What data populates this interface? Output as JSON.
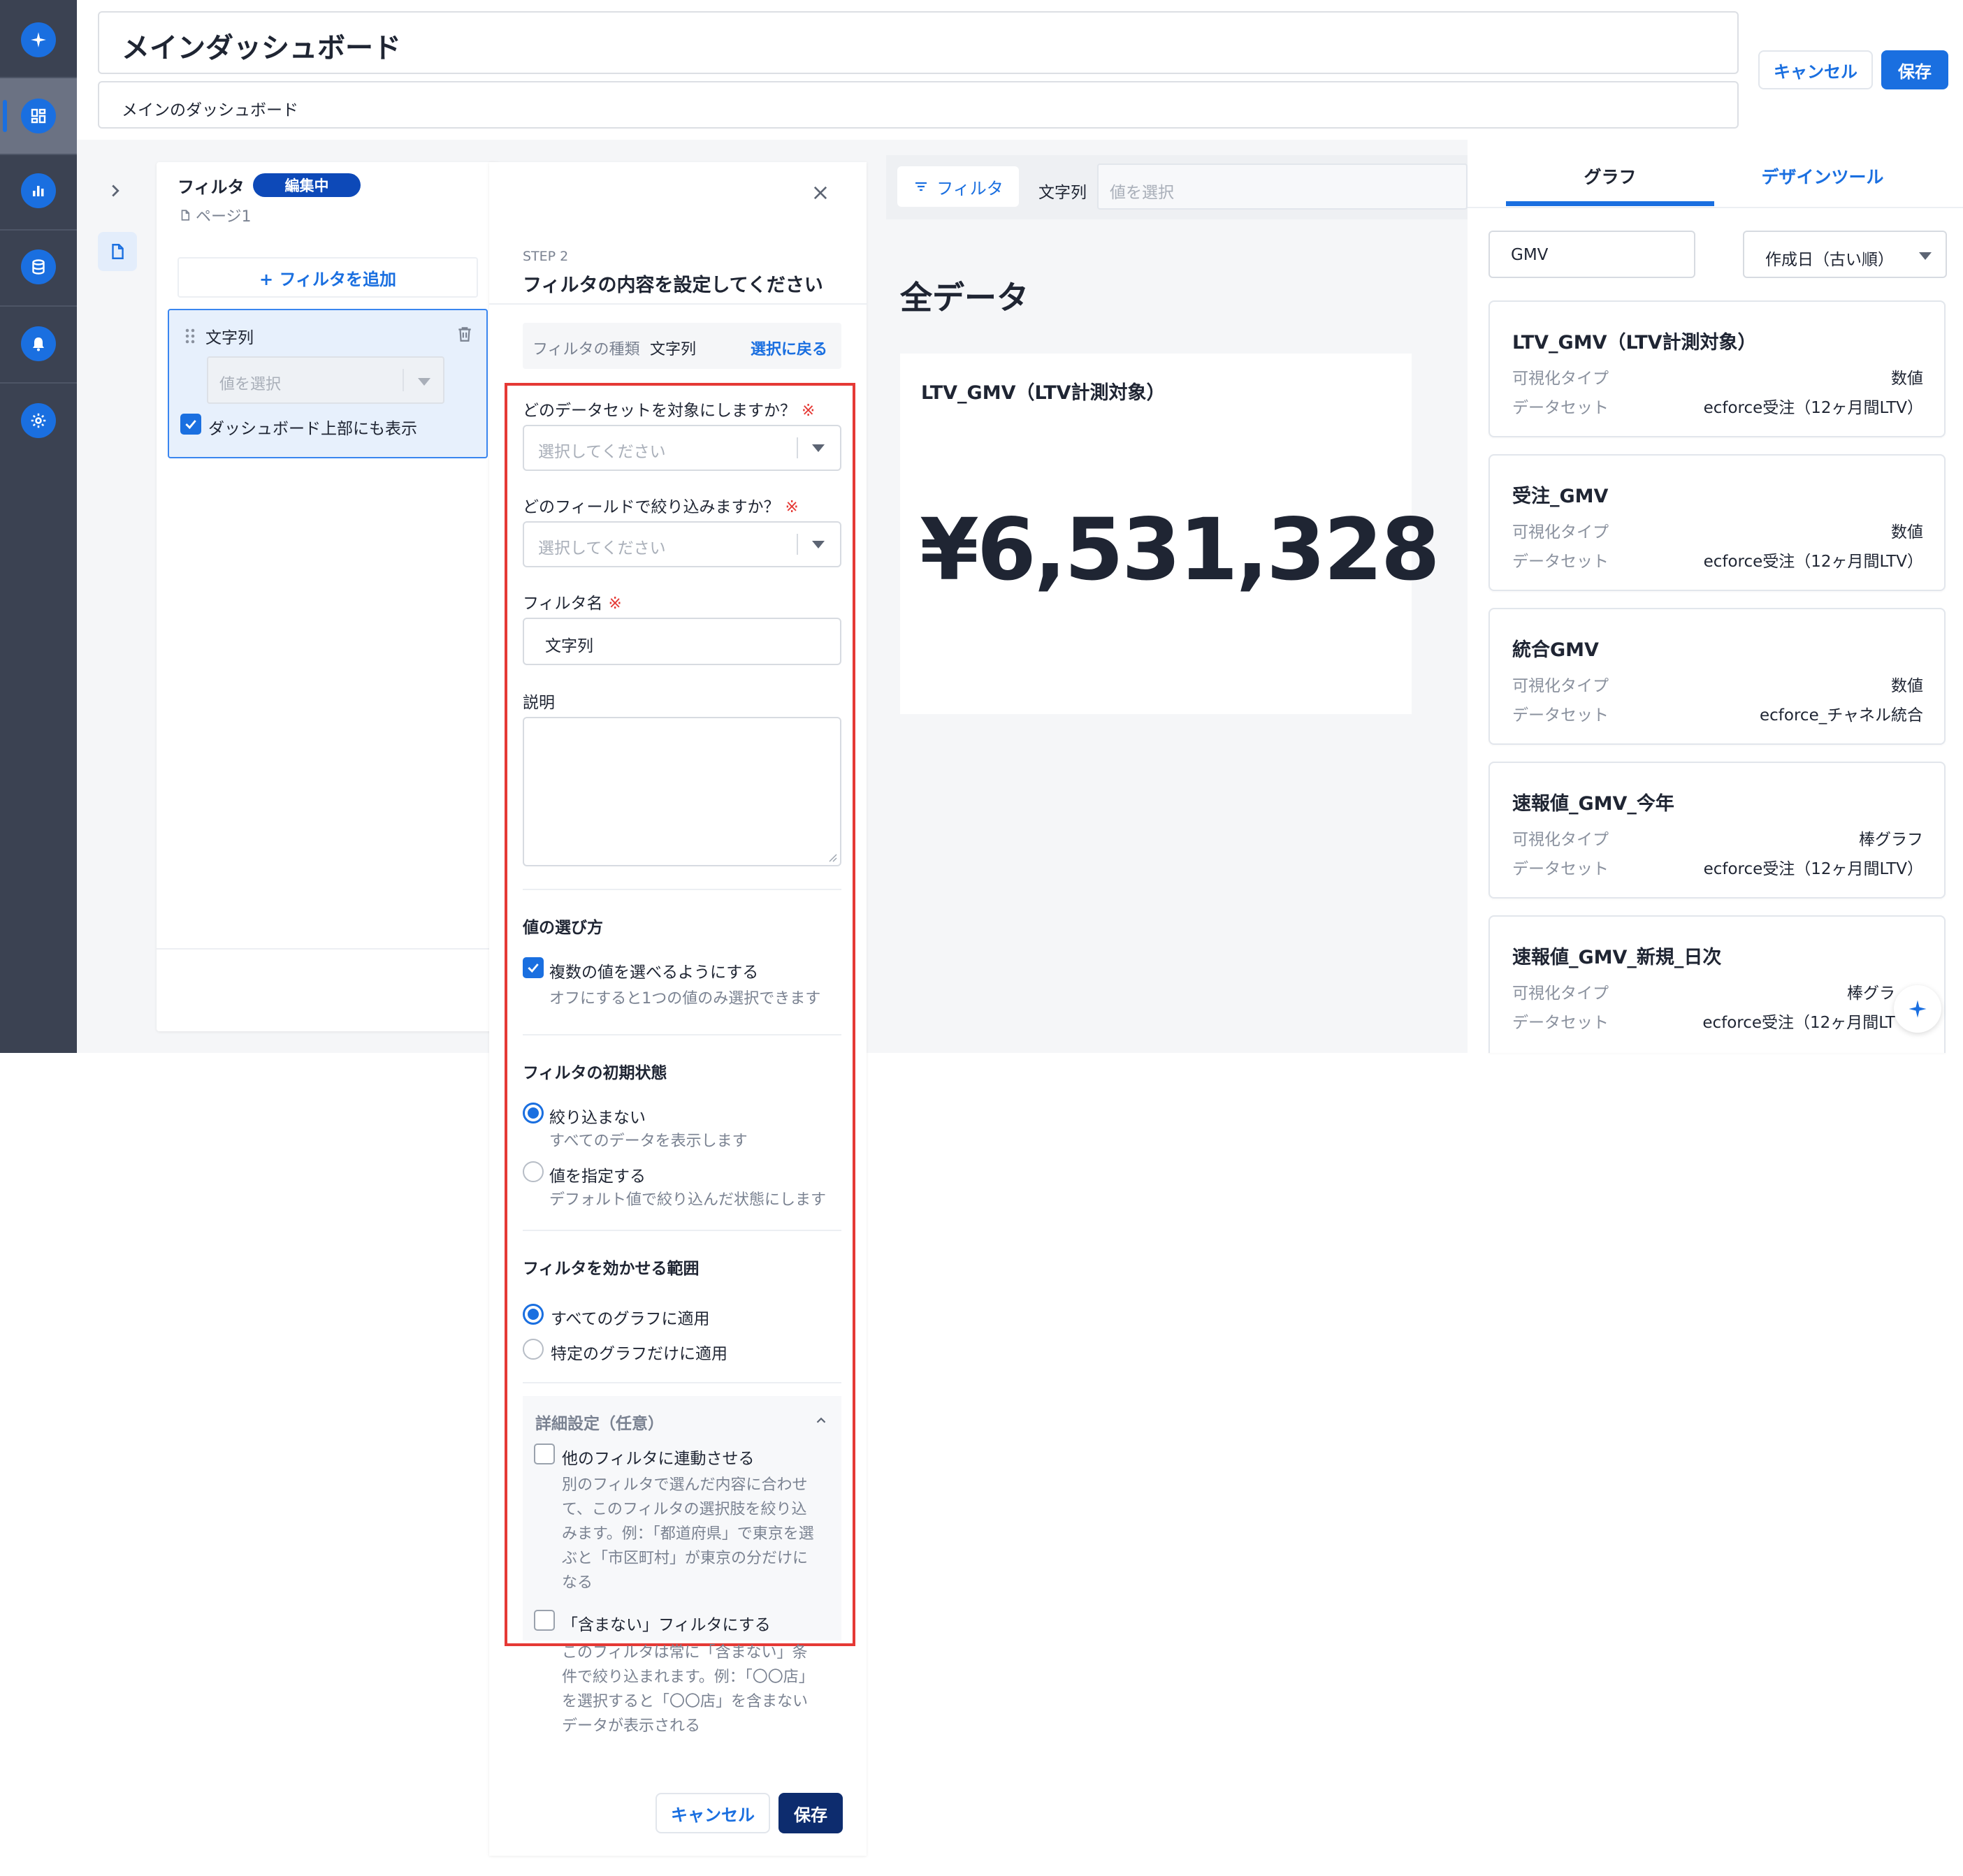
{
  "colors": {
    "accent": "#1a6fe0",
    "sidebar": "#3b4252",
    "primary_dark": "#0d2c6e",
    "required": "#e53935",
    "highlight_border": "#e53935"
  },
  "sidebar": {
    "items": [
      {
        "icon": "sparkle-icon"
      },
      {
        "icon": "dashboard-grid-icon",
        "active": true
      },
      {
        "icon": "bar-chart-icon"
      },
      {
        "icon": "database-icon"
      },
      {
        "icon": "bell-icon"
      },
      {
        "icon": "gear-icon"
      }
    ]
  },
  "header": {
    "title": "メインダッシュボード",
    "subtitle": "メインのダッシュボード",
    "cancel_label": "キャンセル",
    "save_label": "保存"
  },
  "filter_panel": {
    "title": "フィルタ",
    "badge": "編集中",
    "page": "ページ1",
    "add_filter_label": "+ フィルタを追加",
    "item": {
      "name": "文字列",
      "value_placeholder": "値を選択",
      "show_on_top_label": "ダッシュボード上部にも表示",
      "show_on_top_checked": true
    }
  },
  "step": {
    "step_label": "STEP 2",
    "title": "フィルタの内容を設定してください",
    "type_label": "フィルタの種類",
    "type_value": "文字列",
    "back_label": "選択に戻る",
    "dataset_label": "どのデータセットを対象にしますか？",
    "field_label": "どのフィールドで絞り込みますか？",
    "required_mark": "※",
    "select_placeholder": "選択してください",
    "name_label": "フィルタ名",
    "name_value": "文字列",
    "description_label": "説明",
    "value_section": "値の選び方",
    "multi_label": "複数の値を選べるようにする",
    "multi_help": "オフにすると1つの値のみ選択できます",
    "multi_checked": true,
    "initial_section": "フィルタの初期状態",
    "no_filter_label": "絞り込まない",
    "no_filter_help": "すべてのデータを表示します",
    "specify_label": "値を指定する",
    "specify_help": "デフォルト値で絞り込んだ状態にします",
    "scope_section": "フィルタを効かせる範囲",
    "scope_all": "すべてのグラフに適用",
    "scope_specific": "特定のグラフだけに適用",
    "advanced_label": "詳細設定（任意）",
    "link_label": "他のフィルタに連動させる",
    "link_help_lines": [
      "別のフィルタで選んだ内容に合わせ",
      "て、このフィルタの選択肢を絞り込",
      "みます。例：「都道府県」で東京を選",
      "ぶと「市区町村」が東京の分だけに",
      "なる"
    ],
    "exclude_label": "「含まない」フィルタにする",
    "exclude_help_lines": [
      "このフィルタは常に「含まない」条",
      "件で絞り込まれます。例：「〇〇店」",
      "を選択すると「〇〇店」を含まない",
      "データが表示される"
    ],
    "cancel_label": "キャンセル",
    "save_label": "保存"
  },
  "preview": {
    "filter_chip": "フィルタ",
    "field_label": "文字列",
    "value_placeholder": "値を選択",
    "section_title": "全データ",
    "kpi_title": "LTV_GMV（LTV計測対象）",
    "kpi_value": "¥6,531,328"
  },
  "right_panel": {
    "tabs": [
      "グラフ",
      "デザインツール"
    ],
    "active_tab": 0,
    "search_value": "GMV",
    "sort_value": "作成日（古い順）",
    "viz_key": "可視化タイプ",
    "dataset_key": "データセット",
    "cards": [
      {
        "title": "LTV_GMV（LTV計測対象）",
        "viz": "数値",
        "dataset": "ecforce受注（12ヶ月間LTV）"
      },
      {
        "title": "受注_GMV",
        "viz": "数値",
        "dataset": "ecforce受注（12ヶ月間LTV）"
      },
      {
        "title": "統合GMV",
        "viz": "数値",
        "dataset": "ecforce_チャネル統合"
      },
      {
        "title": "速報値_GMV_今年",
        "viz": "棒グラフ",
        "dataset": "ecforce受注（12ヶ月間LTV）"
      },
      {
        "title": "速報値_GMV_新規_日次",
        "viz": "棒グラ",
        "dataset": "ecforce受注（12ヶ月間LT"
      }
    ]
  }
}
